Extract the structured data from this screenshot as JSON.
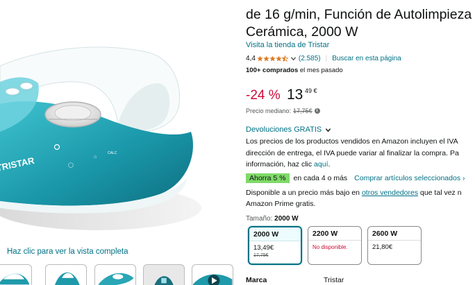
{
  "image_pane": {
    "zoom_hint": "Haz clic para ver la vista completa",
    "brand_on_iron": "TRISTAR",
    "thumbnails": [
      "iron-angle-thumb",
      "iron-side-thumb",
      "iron-top-thumb",
      "iron-dark-thumb",
      "video-thumb"
    ]
  },
  "product": {
    "title_lines": [
      "                                                                   ",
      "de 16 g/min, Función de Autolimpieza",
      "Cerámica, 2000 W"
    ],
    "store_link": "Visita la tienda de Tristar",
    "rating": "4,4",
    "stars_filled": 4.5,
    "rating_count": "(2.585)",
    "search_link": "Buscar en esta página",
    "bought_bold": "100+ comprados",
    "bought_rest": " el mes pasado"
  },
  "price": {
    "discount": "-24 %",
    "whole": "13",
    "fraction": "49 €",
    "median_label": "Precio mediano:",
    "median_value": "17,75€"
  },
  "returns": {
    "label": "Devoluciones GRATIS"
  },
  "tax": {
    "line1": "Los precios de los productos vendidos en Amazon incluyen el IVA",
    "line2": "dirección de entrega, el IVA puede variar al finalizar la compra. Pa",
    "line3_text": "información, haz clic ",
    "line3_link": "aquí",
    "line3_end": "."
  },
  "savings": {
    "badge": "Ahorra 5 %",
    "text": "en cada 4 o más",
    "link": "Comprar artículos seleccionados ›"
  },
  "availability": {
    "line1_text": "Disponible a un precio más bajo en ",
    "line1_link": "otros vendedores",
    "line1_end": " que tal vez n",
    "line2": "Amazon Prime gratis."
  },
  "size": {
    "label": "Tamaño: ",
    "selected": "2000 W",
    "options": [
      {
        "name": "2000 W",
        "price": "13,49€",
        "old_price": "17,75€"
      },
      {
        "name": "2200 W",
        "unavailable": "No disponible."
      },
      {
        "name": "2600 W",
        "price": "21,80€"
      }
    ]
  },
  "specs": {
    "key": "Marca",
    "value": "Tristar"
  },
  "colors": {
    "link": "#007185",
    "discount": "#cc0c39",
    "star": "#de7921",
    "save_badge": "#7fda69",
    "iron_teal": "#1f9aab"
  }
}
